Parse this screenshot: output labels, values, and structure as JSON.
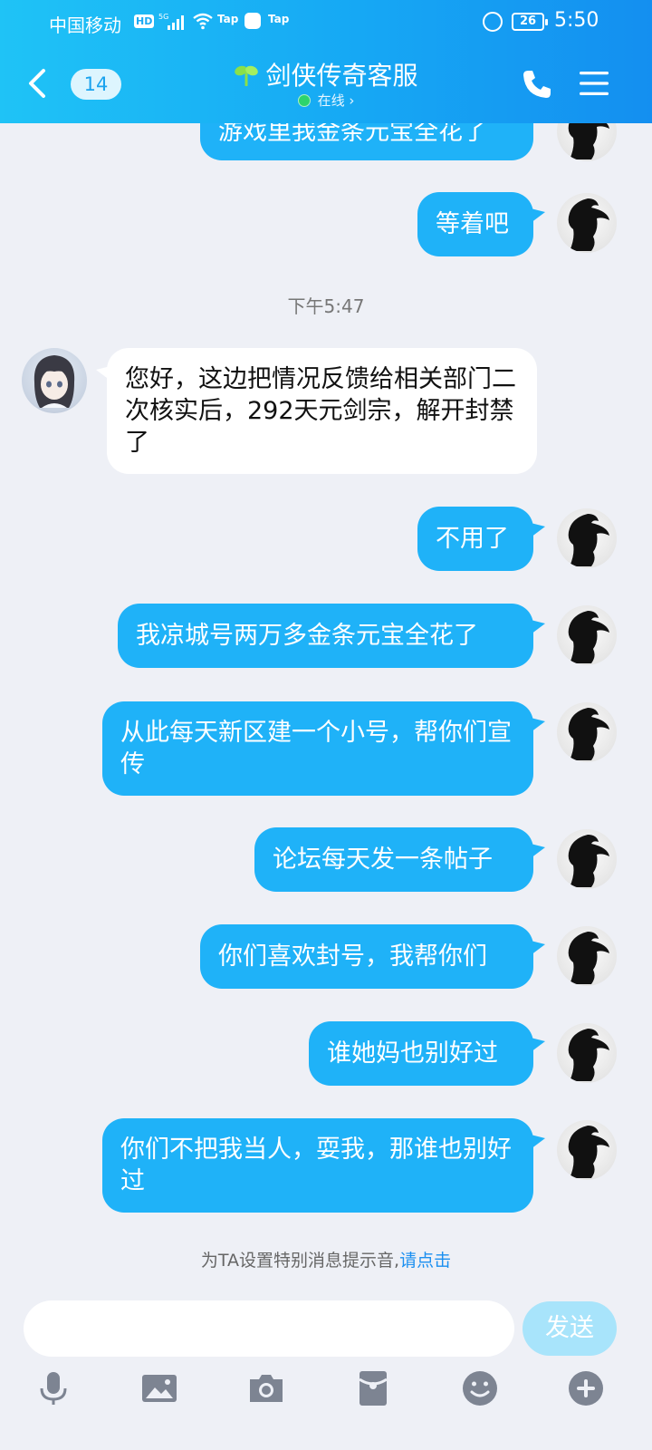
{
  "status_bar": {
    "carrier": "中国移动",
    "hd": "HD",
    "network": "5G",
    "tap1": "Tap",
    "tap2": "Tap",
    "battery": "26",
    "time": "5:50"
  },
  "header": {
    "unread_count": "14",
    "title": "剑侠传奇客服",
    "presence": "在线 ›",
    "icons": [
      "back-chevron-icon",
      "sprout-icon",
      "phone-icon",
      "menu-icon"
    ]
  },
  "chat": {
    "timestamp": "下午5:47",
    "messages": [
      {
        "side": "out",
        "text": "游戏里我金条元宝全花了"
      },
      {
        "side": "out",
        "text": "等着吧"
      },
      {
        "side": "in",
        "text": "您好，这边把情况反馈给相关部门二次核实后，292天元剑宗，解开封禁了"
      },
      {
        "side": "out",
        "text": "不用了"
      },
      {
        "side": "out",
        "text": "我凉城号两万多金条元宝全花了"
      },
      {
        "side": "out",
        "text": "从此每天新区建一个小号，帮你们宣传"
      },
      {
        "side": "out",
        "text": "论坛每天发一条帖子"
      },
      {
        "side": "out",
        "text": "你们喜欢封号，我帮你们"
      },
      {
        "side": "out",
        "text": "谁她妈也别好过"
      },
      {
        "side": "out",
        "text": "你们不把我当人，耍我，那谁也别好过"
      }
    ],
    "tip_text": "为TA设置特别消息提示音,",
    "tip_link": "请点击"
  },
  "input": {
    "value": "",
    "send_label": "发送"
  },
  "toolbar": {
    "icons": [
      "microphone-icon",
      "image-icon",
      "camera-icon",
      "red-packet-icon",
      "emoji-icon",
      "plus-icon"
    ]
  },
  "colors": {
    "header_gradient_start": "#1fc3f6",
    "header_gradient_end": "#148ff0",
    "outgoing_bubble": "#1fb2f8",
    "incoming_bubble": "#ffffff",
    "background": "#eef0f6",
    "send_button": "#a8e4fb",
    "link": "#1b8ff0"
  }
}
